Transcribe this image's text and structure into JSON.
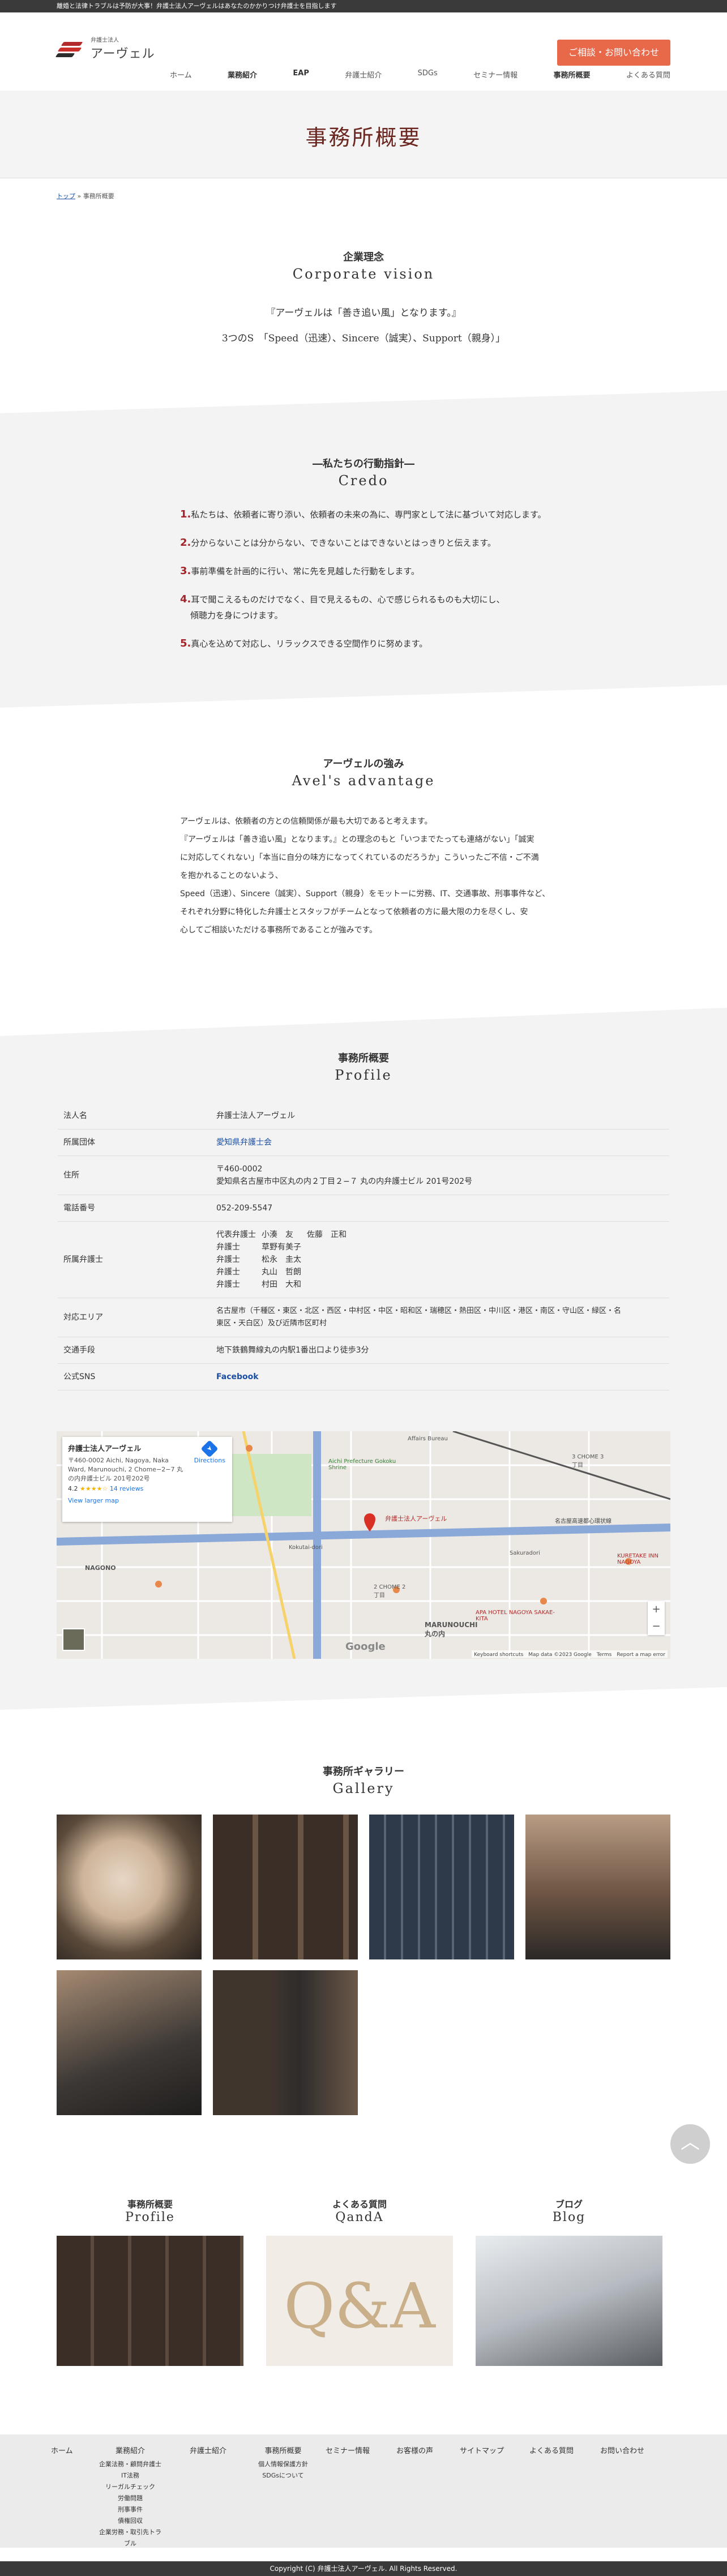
{
  "topbar": {
    "text": "離婚と法律トラブルは予防が大事！弁護士法人アーヴェルはあなたのかかりつけ弁護士を目指します"
  },
  "logo": {
    "small": "弁護士法人",
    "name": "アーヴェル"
  },
  "cta": {
    "label": "ご相談・お問い合わせ"
  },
  "nav": [
    "ホーム",
    "業務紹介",
    "EAP",
    "弁護士紹介",
    "SDGs",
    "セミナー情報",
    "事務所概要",
    "よくある質問"
  ],
  "hero": {
    "title": "事務所概要"
  },
  "breadcrumb": {
    "home": "トップ",
    "sep": "»",
    "current": "事務所概要"
  },
  "philosophy": {
    "title_jp": "企業理念",
    "title_en": "Corporate vision",
    "line1": "『アーヴェルは「善き追い風」となります。』",
    "line2": "3つのS　「Speed（迅速）、Sincere（誠実）、Support（親身）」"
  },
  "credo": {
    "title_jp": "―私たちの行動指針―",
    "title_en": "Credo",
    "items": [
      {
        "n": "1.",
        "text": "私たちは、依頼者に寄り添い、依頼者の未来の為に、専門家として法に基づいて対応します。"
      },
      {
        "n": "2.",
        "text": "分からないことは分からない、できないことはできないとはっきりと伝えます。"
      },
      {
        "n": "3.",
        "text": "事前準備を計画的に行い、常に先を見越した行動をします。"
      },
      {
        "n": "4.",
        "text": "耳で聞こえるものだけでなく、目で見えるもの、心で感じられるものも大切にし、",
        "text2": "傾聴力を身につけます。"
      },
      {
        "n": "5.",
        "text": "真心を込めて対応し、リラックスできる空間作りに努めます。"
      }
    ]
  },
  "advantage": {
    "title_jp": "アーヴェルの強み",
    "title_en": "Avel's advantage",
    "lines": [
      "アーヴェルは、依頼者の方との信頼関係が最も大切であると考えます。",
      "『アーヴェルは「善き追い風」となります。』との理念のもと「いつまでたっても連絡がない」「誠実",
      "に対応してくれない」「本当に自分の味方になってくれているのだろうか」こういったご不信・ご不満",
      "を抱かれることのないよう、",
      "Speed（迅速）、Sincere（誠実）、Support（親身）をモットーに労務、IT、交通事故、刑事事件など、",
      "それぞれ分野に特化した弁護士とスタッフがチームとなって依頼者の方に最大限の力を尽くし、安",
      "心してご相談いただける事務所であることが強みです。"
    ]
  },
  "profile": {
    "title_jp": "事務所概要",
    "title_en": "Profile",
    "rows": [
      {
        "k": "法人名",
        "v": "弁護士法人アーヴェル"
      },
      {
        "k": "所属団体",
        "v": "愛知県弁護士会",
        "link": true
      },
      {
        "k": "住所",
        "v": "〒460-0002",
        "v2": "愛知県名古屋市中区丸の内２丁目２−７ 丸の内弁護士ビル 201号202号"
      },
      {
        "k": "電話番号",
        "v": "052-209-5547"
      },
      {
        "k": "所属弁護士",
        "lawyers": [
          [
            "代表弁護士",
            "小湊　友",
            "佐藤　正和"
          ],
          [
            "弁護士",
            "草野有美子",
            ""
          ],
          [
            "弁護士",
            "松永　圭太",
            ""
          ],
          [
            "弁護士",
            "丸山　哲朗",
            ""
          ],
          [
            "弁護士",
            "村田　大和",
            ""
          ]
        ]
      },
      {
        "k": "対応エリア",
        "v": "名古屋市（千種区・東区・北区・西区・中村区・中区・昭和区・瑞穂区・熱田区・中川区・港区・南区・守山区・緑区・名",
        "v2": "東区・天白区）及び近隣市区町村"
      },
      {
        "k": "交通手段",
        "v": "地下鉄鶴舞線丸の内駅1番出口より徒歩3分"
      },
      {
        "k": "公式SNS",
        "v": "Facebook",
        "link": true
      }
    ]
  },
  "map": {
    "card_title": "弁護士法人アーヴェル",
    "card_addr1": "〒460-0002 Aichi, Nagoya, Naka",
    "card_addr2": "Ward, Marunouchi, 2 Chome−2−7 丸",
    "card_addr3": "の内弁護士ビル 201号202号",
    "rating": "4.2",
    "stars": "★★★★☆",
    "reviews": "14 reviews",
    "view_larger": "View larger map",
    "directions": "Directions",
    "labels": [
      "Affairs Bureau",
      "Aichi Prefecture Gokoku Shrine",
      "名古屋高速都心環状線",
      "MARUNOUCHI 丸の内",
      "APA HOTEL NAGOYA SAKAE-KITA",
      "KURETAKE INN NAGOYA",
      "2 CHOME 2丁目",
      "3 CHOME 3丁目",
      "NAGONO",
      "Kokutai-dori",
      "Sakuradori"
    ],
    "footer": "Keyboard shortcuts　Map data ©2023 Google　Terms　Report a map error",
    "google": "Google"
  },
  "gallery": {
    "title_jp": "事務所ギャラリー",
    "title_en": "Gallery"
  },
  "bottom_links": [
    {
      "jp": "事務所概要",
      "en": "Profile"
    },
    {
      "jp": "よくある質問",
      "en": "QandA"
    },
    {
      "jp": "ブログ",
      "en": "Blog"
    }
  ],
  "footer": {
    "cols": [
      {
        "label": "ホーム",
        "sub": []
      },
      {
        "label": "業務紹介",
        "sub": [
          "企業法務・顧問弁護士",
          "IT法務",
          "リーガルチェック",
          "労働問題",
          "刑事事件",
          "債権回収",
          "企業労務・取引先トラブル"
        ]
      },
      {
        "label": "弁護士紹介",
        "sub": []
      },
      {
        "label": "事務所概要",
        "sub": [
          "個人情報保護方針",
          "SDGsについて"
        ]
      },
      {
        "label": "セミナー情報",
        "sub": []
      },
      {
        "label": "お客様の声",
        "sub": []
      },
      {
        "label": "サイトマップ",
        "sub": []
      },
      {
        "label": "よくある質問",
        "sub": []
      },
      {
        "label": "お問い合わせ",
        "sub": []
      }
    ],
    "copyright": "Copyright (C) 弁護士法人アーヴェル. All Rights Reserved."
  },
  "colors": {
    "accent": "#e8684a",
    "heading": "#6b2620",
    "credo_num": "#a3232b",
    "link": "#1a4ea3"
  }
}
